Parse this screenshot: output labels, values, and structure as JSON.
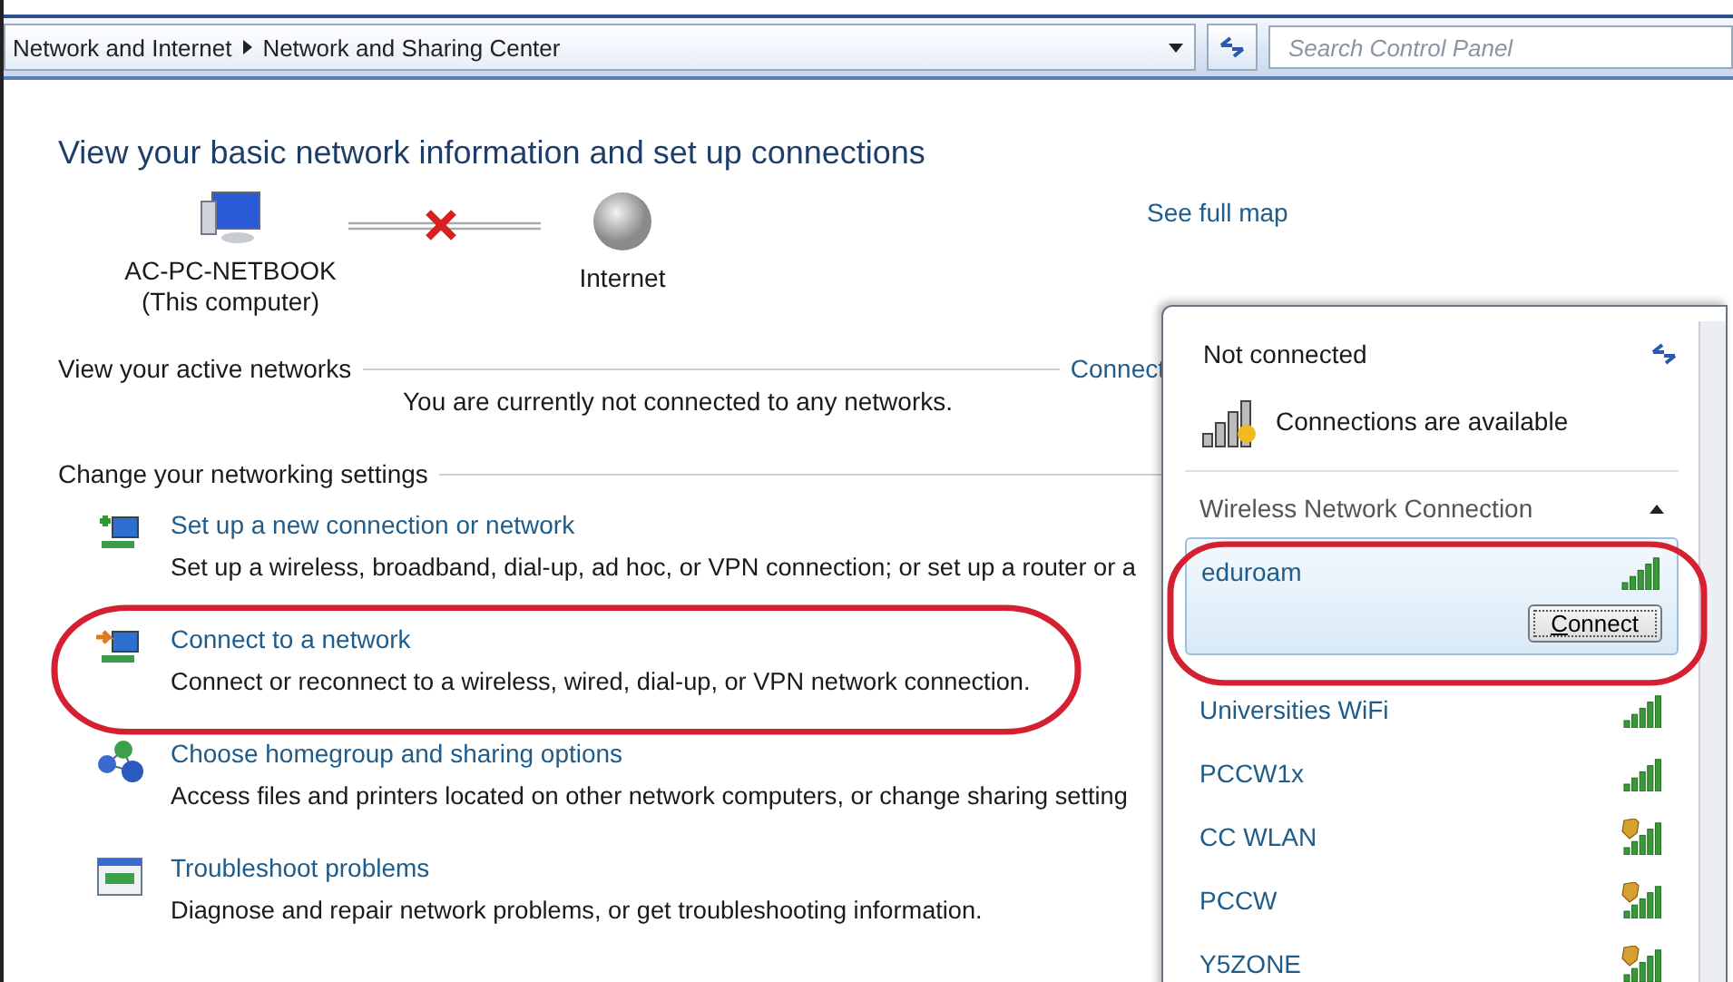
{
  "breadcrumb": [
    {
      "label": "Network and Internet"
    },
    {
      "label": "Network and Sharing Center"
    }
  ],
  "search": {
    "placeholder": "Search Control Panel"
  },
  "heading": "View your basic network information and set up connections",
  "map": {
    "computer": "AC-PC-NETBOOK",
    "computer_note": "(This computer)",
    "internet": "Internet",
    "connected": false,
    "link": "See full map"
  },
  "active_networks": {
    "title": "View your active networks",
    "link": "Connect",
    "message": "You are currently not connected to any networks."
  },
  "settings": {
    "title": "Change your networking settings",
    "tasks": [
      {
        "kind": "new-connection",
        "link": "Set up a new connection or network",
        "description": "Set up a wireless, broadband, dial-up, ad hoc, or VPN connection; or set up a router or a",
        "highlighted": false
      },
      {
        "kind": "connect",
        "link": "Connect to a network",
        "description": "Connect or reconnect to a wireless, wired, dial-up, or VPN network connection.",
        "highlighted": true
      },
      {
        "kind": "homegroup",
        "link": "Choose homegroup and sharing options",
        "description": "Access files and printers located on other network computers, or change sharing setting",
        "highlighted": false
      },
      {
        "kind": "troubleshoot",
        "link": "Troubleshoot problems",
        "description": "Diagnose and repair network problems, or get troubleshooting information.",
        "highlighted": false
      }
    ]
  },
  "flyout": {
    "status": "Not connected",
    "availability": "Connections are available",
    "group": {
      "title": "Wireless Network Connection",
      "expanded": true
    },
    "networks": [
      {
        "name": "eduroam",
        "secured": false,
        "selected": true,
        "highlighted": true,
        "button": "Connect"
      },
      {
        "name": "Universities WiFi",
        "secured": false,
        "selected": false,
        "highlighted": false
      },
      {
        "name": "PCCW1x",
        "secured": false,
        "selected": false,
        "highlighted": false
      },
      {
        "name": "CC WLAN",
        "secured": true,
        "selected": false,
        "highlighted": false
      },
      {
        "name": "PCCW",
        "secured": true,
        "selected": false,
        "highlighted": false
      },
      {
        "name": "Y5ZONE",
        "secured": true,
        "selected": false,
        "highlighted": false
      }
    ]
  }
}
